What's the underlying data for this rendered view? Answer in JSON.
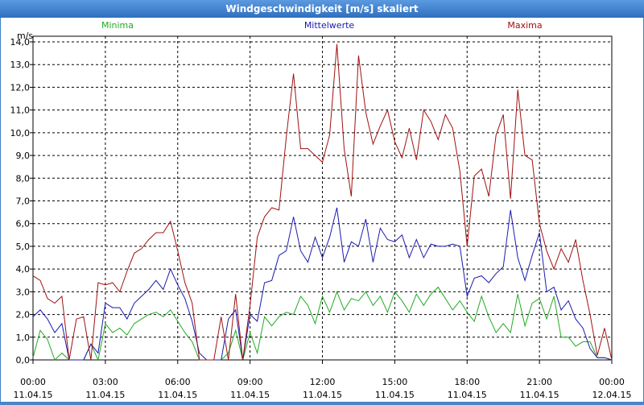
{
  "window": {
    "title": "Windgeschwindigkeit [m/s] skaliert"
  },
  "colors": {
    "min": "#22aa22",
    "avg": "#1a1ab0",
    "max": "#a01010"
  },
  "chart_data": {
    "type": "line",
    "title": "Windgeschwindigkeit [m/s] skaliert",
    "ylabel": "m/s",
    "ylim": [
      0,
      14
    ],
    "yticks": [
      "0,0",
      "1,0",
      "2,0",
      "3,0",
      "4,0",
      "5,0",
      "6,0",
      "7,0",
      "8,0",
      "9,0",
      "10,0",
      "11,0",
      "12,0",
      "13,0",
      "14,0"
    ],
    "xlim": [
      0,
      24
    ],
    "xticks": [
      {
        "h": 0,
        "time": "00:00",
        "date": "11.04.15"
      },
      {
        "h": 3,
        "time": "03:00",
        "date": "11.04.15"
      },
      {
        "h": 6,
        "time": "06:00",
        "date": "11.04.15"
      },
      {
        "h": 9,
        "time": "09:00",
        "date": "11.04.15"
      },
      {
        "h": 12,
        "time": "12:00",
        "date": "11.04.15"
      },
      {
        "h": 15,
        "time": "15:00",
        "date": "11.04.15"
      },
      {
        "h": 18,
        "time": "18:00",
        "date": "11.04.15"
      },
      {
        "h": 21,
        "time": "21:00",
        "date": "11.04.15"
      },
      {
        "h": 24,
        "time": "00:00",
        "date": "12.04.15"
      }
    ],
    "grid": true,
    "legend_position": "top",
    "series": [
      {
        "name": "Minima",
        "key": "min",
        "x": [
          0,
          0.3,
          0.6,
          0.9,
          1.2,
          1.5,
          1.8,
          2.1,
          2.4,
          2.7,
          3.0,
          3.3,
          3.6,
          3.9,
          4.2,
          4.5,
          4.8,
          5.1,
          5.4,
          5.7,
          6.0,
          6.3,
          6.6,
          6.9,
          7.2,
          7.5,
          7.8,
          8.1,
          8.4,
          8.7,
          9.0,
          9.3,
          9.6,
          9.9,
          10.2,
          10.5,
          10.8,
          11.1,
          11.4,
          11.7,
          12.0,
          12.3,
          12.6,
          12.9,
          13.2,
          13.5,
          13.8,
          14.1,
          14.4,
          14.7,
          15.0,
          15.3,
          15.6,
          15.9,
          16.2,
          16.5,
          16.8,
          17.1,
          17.4,
          17.7,
          18.0,
          18.3,
          18.6,
          18.9,
          19.2,
          19.5,
          19.8,
          20.1,
          20.4,
          20.7,
          21.0,
          21.3,
          21.6,
          21.9,
          22.2,
          22.5,
          22.8,
          23.1,
          23.4,
          23.7,
          24.0
        ],
        "values": [
          0.1,
          1.3,
          0.9,
          0.0,
          0.3,
          0.0,
          0.0,
          0.0,
          0.7,
          0.0,
          1.6,
          1.2,
          1.4,
          1.1,
          1.6,
          1.8,
          2.0,
          2.1,
          1.9,
          2.2,
          1.7,
          1.2,
          0.8,
          0.0,
          0.0,
          0.0,
          0.0,
          0.3,
          1.3,
          0.0,
          1.2,
          0.3,
          1.9,
          1.5,
          1.9,
          2.1,
          2.0,
          2.8,
          2.4,
          1.6,
          2.8,
          2.1,
          3.0,
          2.2,
          2.7,
          2.6,
          3.0,
          2.4,
          2.8,
          2.1,
          3.0,
          2.6,
          2.1,
          2.9,
          2.4,
          2.9,
          3.2,
          2.7,
          2.2,
          2.6,
          2.1,
          1.7,
          2.8,
          1.9,
          1.2,
          1.6,
          1.2,
          2.9,
          1.5,
          2.5,
          2.7,
          1.8,
          2.8,
          1.0,
          1.0,
          0.6,
          0.8,
          0.8,
          0.1,
          0.1,
          0.0
        ]
      },
      {
        "name": "Mittelwerte",
        "key": "avg",
        "x": [
          0,
          0.3,
          0.6,
          0.9,
          1.2,
          1.5,
          1.8,
          2.1,
          2.4,
          2.7,
          3.0,
          3.3,
          3.6,
          3.9,
          4.2,
          4.5,
          4.8,
          5.1,
          5.4,
          5.7,
          6.0,
          6.3,
          6.6,
          6.9,
          7.2,
          7.5,
          7.8,
          8.1,
          8.4,
          8.7,
          9.0,
          9.3,
          9.6,
          9.9,
          10.2,
          10.5,
          10.8,
          11.1,
          11.4,
          11.7,
          12.0,
          12.3,
          12.6,
          12.9,
          13.2,
          13.5,
          13.8,
          14.1,
          14.4,
          14.7,
          15.0,
          15.3,
          15.6,
          15.9,
          16.2,
          16.5,
          16.8,
          17.1,
          17.4,
          17.7,
          18.0,
          18.3,
          18.6,
          18.9,
          19.2,
          19.5,
          19.8,
          20.1,
          20.4,
          20.7,
          21.0,
          21.3,
          21.6,
          21.9,
          22.2,
          22.5,
          22.8,
          23.1,
          23.4,
          23.7,
          24.0
        ],
        "values": [
          1.9,
          2.2,
          1.8,
          1.2,
          1.6,
          0.0,
          0.0,
          0.0,
          0.7,
          0.3,
          2.5,
          2.3,
          2.3,
          1.8,
          2.5,
          2.8,
          3.1,
          3.5,
          3.1,
          4.0,
          3.3,
          2.7,
          1.7,
          0.3,
          0.0,
          0.0,
          0.0,
          1.8,
          2.2,
          0.0,
          2.0,
          1.7,
          3.4,
          3.5,
          4.6,
          4.8,
          6.3,
          4.8,
          4.3,
          5.4,
          4.5,
          5.4,
          6.7,
          4.3,
          5.2,
          5.0,
          6.2,
          4.3,
          5.8,
          5.3,
          5.2,
          5.5,
          4.5,
          5.3,
          4.5,
          5.1,
          5.0,
          5.0,
          5.1,
          5.0,
          2.8,
          3.6,
          3.7,
          3.4,
          3.8,
          4.1,
          6.6,
          4.5,
          3.5,
          4.6,
          5.6,
          3.0,
          3.2,
          2.2,
          2.6,
          1.8,
          1.4,
          0.5,
          0.1,
          0.1,
          0.0
        ]
      },
      {
        "name": "Maxima",
        "key": "max",
        "x": [
          0,
          0.3,
          0.6,
          0.9,
          1.2,
          1.5,
          1.8,
          2.1,
          2.4,
          2.7,
          3.0,
          3.3,
          3.6,
          3.9,
          4.2,
          4.5,
          4.8,
          5.1,
          5.4,
          5.7,
          6.0,
          6.3,
          6.6,
          6.9,
          7.2,
          7.5,
          7.8,
          8.1,
          8.4,
          8.7,
          9.0,
          9.3,
          9.6,
          9.9,
          10.2,
          10.5,
          10.8,
          11.1,
          11.4,
          11.7,
          12.0,
          12.3,
          12.6,
          12.9,
          13.2,
          13.5,
          13.8,
          14.1,
          14.4,
          14.7,
          15.0,
          15.3,
          15.6,
          15.9,
          16.2,
          16.5,
          16.8,
          17.1,
          17.4,
          17.7,
          18.0,
          18.3,
          18.6,
          18.9,
          19.2,
          19.5,
          19.8,
          20.1,
          20.4,
          20.7,
          21.0,
          21.3,
          21.6,
          21.9,
          22.2,
          22.5,
          22.8,
          23.1,
          23.4,
          23.7,
          24.0
        ],
        "values": [
          3.7,
          3.5,
          2.7,
          2.5,
          2.8,
          0.0,
          1.8,
          1.9,
          0.0,
          3.4,
          3.3,
          3.4,
          3.0,
          3.9,
          4.7,
          4.9,
          5.3,
          5.6,
          5.6,
          6.1,
          4.8,
          3.4,
          2.5,
          0.0,
          0.0,
          0.0,
          1.9,
          0.0,
          2.9,
          0.0,
          2.4,
          5.4,
          6.3,
          6.7,
          6.6,
          9.8,
          12.6,
          9.3,
          9.3,
          9.0,
          8.7,
          9.9,
          13.9,
          9.3,
          7.2,
          13.4,
          10.9,
          9.5,
          10.3,
          11.0,
          9.6,
          8.9,
          10.2,
          8.8,
          11.0,
          10.5,
          9.7,
          10.8,
          10.2,
          8.3,
          5.0,
          8.1,
          8.4,
          7.2,
          9.9,
          10.8,
          7.1,
          11.9,
          9.0,
          8.8,
          6.0,
          4.8,
          4.0,
          4.9,
          4.3,
          5.3,
          3.5,
          2.0,
          0.2,
          1.4,
          0.0
        ]
      }
    ]
  }
}
